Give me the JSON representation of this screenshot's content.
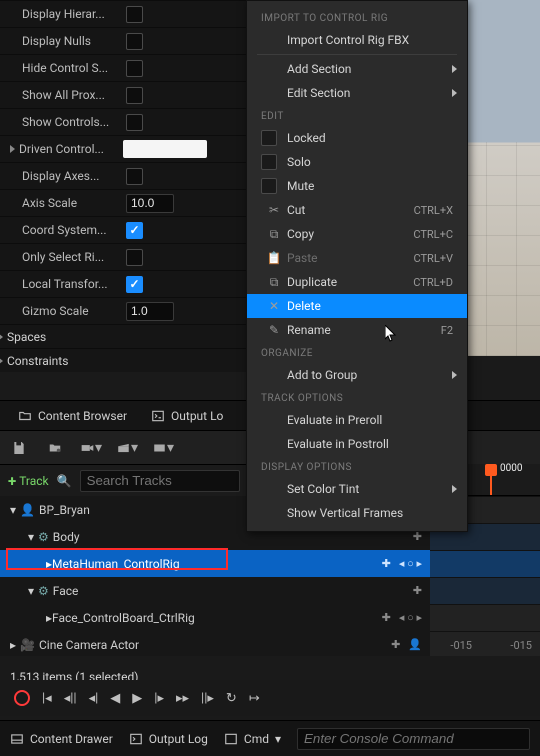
{
  "details": {
    "rows": [
      {
        "label": "Display Hierar...",
        "type": "check",
        "value": false
      },
      {
        "label": "Display Nulls",
        "type": "check",
        "value": false
      },
      {
        "label": "Hide Control S...",
        "type": "check",
        "value": false
      },
      {
        "label": "Show All Prox...",
        "type": "check",
        "value": false
      },
      {
        "label": "Show Controls...",
        "type": "check",
        "value": false
      },
      {
        "label": "Driven Control...",
        "type": "color",
        "value": "#f5f5f5",
        "section": true
      },
      {
        "label": "Display Axes...",
        "type": "check",
        "value": false
      },
      {
        "label": "Axis Scale",
        "type": "text",
        "value": "10.0"
      },
      {
        "label": "Coord System...",
        "type": "check",
        "value": true
      },
      {
        "label": "Only Select Ri...",
        "type": "check",
        "value": false
      },
      {
        "label": "Local Transfor...",
        "type": "check",
        "value": true
      },
      {
        "label": "Gizmo Scale",
        "type": "text",
        "value": "1.0"
      }
    ],
    "sections": [
      "Spaces",
      "Constraints"
    ]
  },
  "tabs": {
    "content": "Content Browser",
    "output": "Output Lo"
  },
  "sequencer": {
    "add_track": "Track",
    "search_placeholder": "Search Tracks",
    "frame": "0000",
    "tracks": [
      {
        "label": "BP_Bryan",
        "depth": 0,
        "icons": "eye",
        "plus": false
      },
      {
        "label": "Body",
        "depth": 1,
        "plus": true
      },
      {
        "label": "MetaHuman_ControlRig",
        "depth": 2,
        "selected": true,
        "plus": true,
        "navicons": true
      },
      {
        "label": "Face",
        "depth": 1,
        "plus": true
      },
      {
        "label": "Face_ControlBoard_CtrlRig",
        "depth": 2,
        "plus": true,
        "nav": true
      },
      {
        "label": "Cine Camera Actor",
        "depth": 0,
        "plus": true,
        "extra": true
      }
    ],
    "items_text": "1,513 items (1 selected)",
    "time_left": "-015",
    "time_right": "-015"
  },
  "status": {
    "drawer": "Content Drawer",
    "output": "Output Log",
    "cmd": "Cmd",
    "console_placeholder": "Enter Console Command"
  },
  "menu": {
    "h_import": "IMPORT TO CONTROL RIG",
    "import_fbx": "Import Control Rig FBX",
    "add_section": "Add Section",
    "edit_section": "Edit Section",
    "h_edit": "EDIT",
    "locked": "Locked",
    "solo": "Solo",
    "mute": "Mute",
    "cut": "Cut",
    "cut_sc": "CTRL+X",
    "copy": "Copy",
    "copy_sc": "CTRL+C",
    "paste": "Paste",
    "paste_sc": "CTRL+V",
    "dup": "Duplicate",
    "dup_sc": "CTRL+D",
    "del": "Delete",
    "ren": "Rename",
    "ren_sc": "F2",
    "h_org": "ORGANIZE",
    "add_group": "Add to Group",
    "h_track": "TRACK OPTIONS",
    "preroll": "Evaluate in Preroll",
    "postroll": "Evaluate in Postroll",
    "h_disp": "DISPLAY OPTIONS",
    "tint": "Set Color Tint",
    "vframes": "Show Vertical Frames"
  }
}
